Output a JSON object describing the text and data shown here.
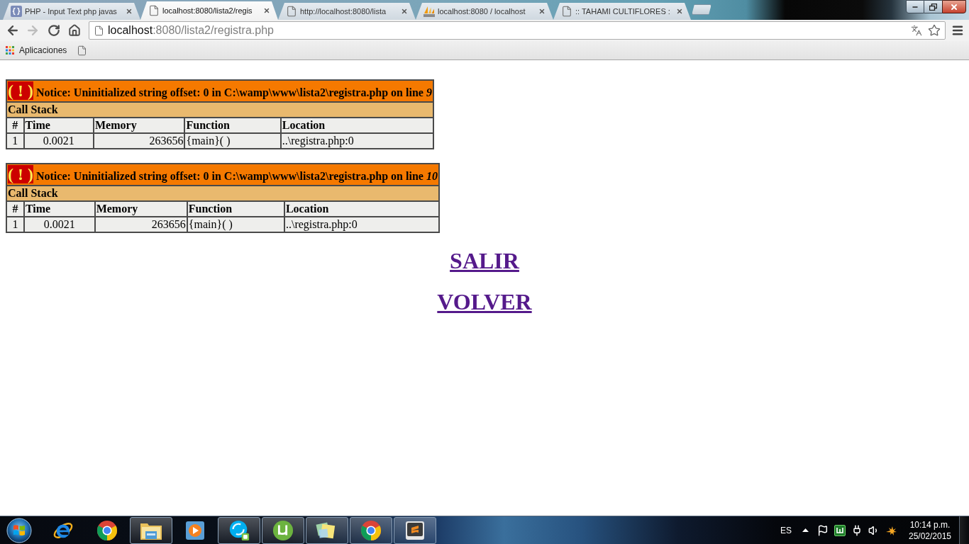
{
  "browser": {
    "tabs": [
      {
        "title": "PHP - Input Text php javas",
        "kind": "braces",
        "selected": false
      },
      {
        "title": "localhost:8080/lista2/regis",
        "kind": "page",
        "selected": true
      },
      {
        "title": "http://localhost:8080/lista",
        "kind": "page",
        "selected": false
      },
      {
        "title": "localhost:8080 / localhost",
        "kind": "sails",
        "selected": false
      },
      {
        "title": ":: TAHAMI CULTIFLORES :",
        "kind": "page",
        "selected": false
      }
    ],
    "navigation": {
      "back_disabled": false,
      "forward_disabled": true
    },
    "address": {
      "host": "localhost",
      "rest": ":8080/lista2/registra.php"
    },
    "bookmarks": [
      {
        "kind": "apps",
        "label": "Aplicaciones"
      },
      {
        "kind": "page"
      }
    ]
  },
  "notices": [
    {
      "badge": "( ! )",
      "message": "Notice: Uninitialized string offset: 0 in C:\\wamp\\www\\lista2\\registra.php on line *9*",
      "stack_title": "Call Stack",
      "columns": [
        "#",
        "Time",
        "Memory",
        "Function",
        "Location"
      ],
      "rows": [
        [
          "1",
          "0.0021",
          "263656",
          "{main}( )",
          "..\\registra.php:0"
        ]
      ]
    },
    {
      "badge": "( ! )",
      "message": "Notice: Uninitialized string offset: 0 in C:\\wamp\\www\\lista2\\registra.php on line *10*",
      "stack_title": "Call Stack",
      "columns": [
        "#",
        "Time",
        "Memory",
        "Function",
        "Location"
      ],
      "rows": [
        [
          "1",
          "0.0021",
          "263656",
          "{main}( )",
          "..\\registra.php:0"
        ]
      ]
    }
  ],
  "links": [
    {
      "label": "SALIR",
      "visited": true
    },
    {
      "label": "VOLVER",
      "visited": true
    }
  ],
  "taskbar": {
    "apps": [
      {
        "kind": "ie",
        "open": false
      },
      {
        "kind": "chrome",
        "open": false
      },
      {
        "kind": "folder",
        "open": true
      },
      {
        "kind": "media",
        "open": false
      },
      {
        "kind": "skype",
        "open": true
      },
      {
        "kind": "torrent",
        "open": true
      },
      {
        "kind": "notes",
        "open": true
      },
      {
        "kind": "chrome",
        "open": true
      },
      {
        "kind": "sublime",
        "open": true
      }
    ],
    "language": "ES",
    "time": "10:14 p.m.",
    "date": "25/02/2015"
  }
}
